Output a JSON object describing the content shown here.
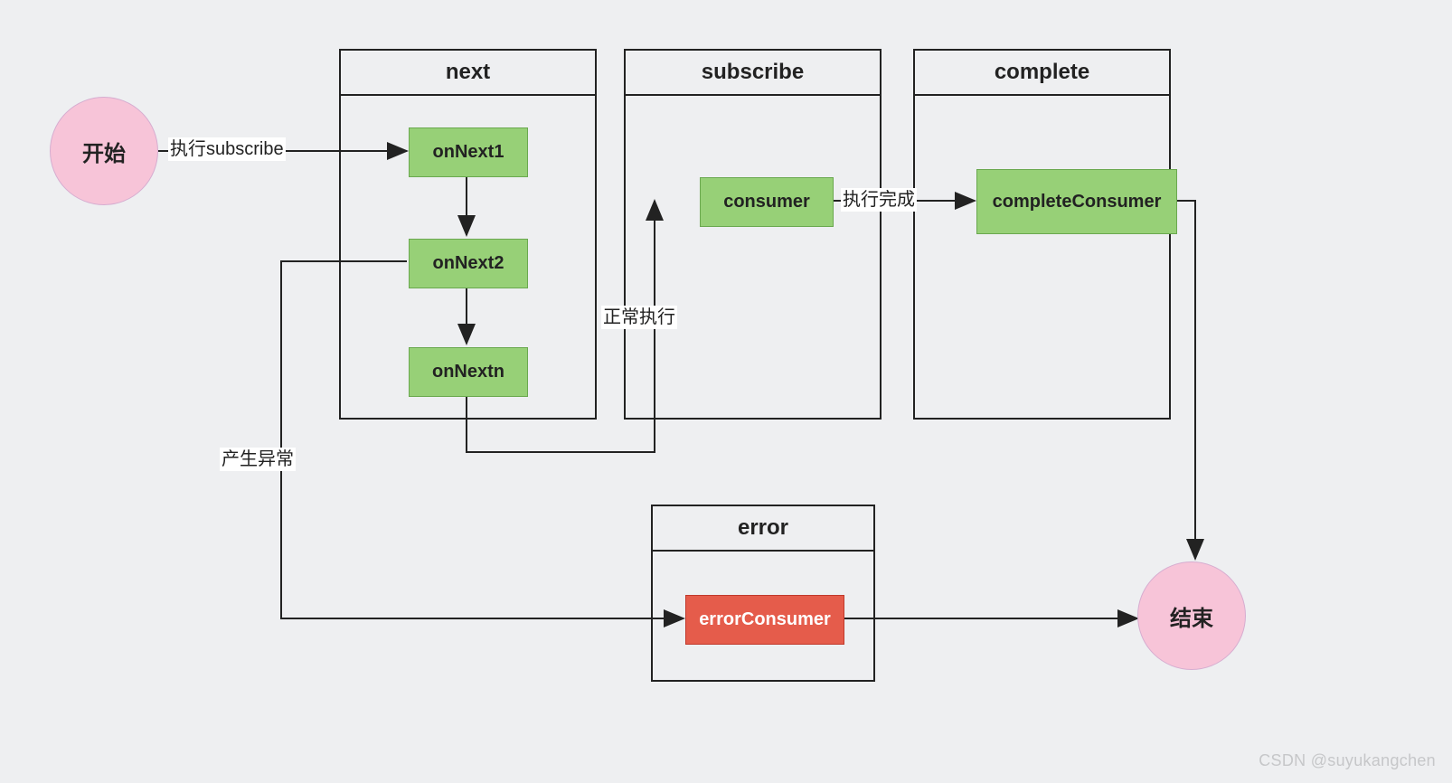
{
  "nodes": {
    "start": "开始",
    "end": "结束"
  },
  "packages": {
    "next": {
      "title": "next",
      "items": [
        "onNext1",
        "onNext2",
        "onNextn"
      ]
    },
    "subscribe": {
      "title": "subscribe",
      "items": [
        "consumer"
      ]
    },
    "complete": {
      "title": "complete",
      "items": [
        "completeConsumer"
      ]
    },
    "error": {
      "title": "error",
      "items": [
        "errorConsumer"
      ]
    }
  },
  "edges": {
    "start_to_next": "执行subscribe",
    "next_to_subscribe": "正常执行",
    "subscribe_to_complete": "执行完成",
    "next_to_error": "产生异常"
  },
  "watermark": "CSDN @suyukangchen"
}
